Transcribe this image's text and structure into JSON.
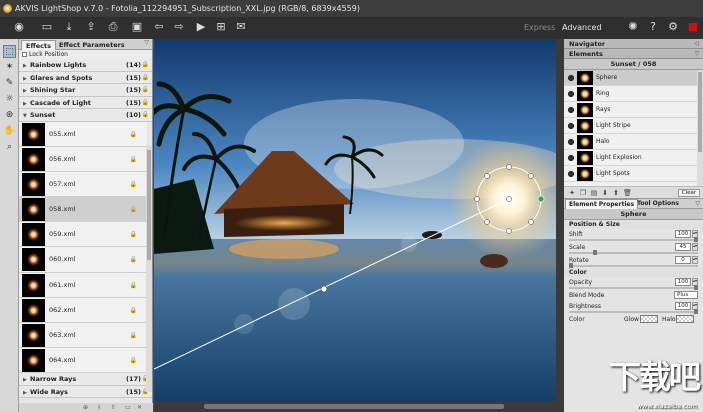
{
  "window": {
    "title": "AKVIS LightShop v.7.0 - Fotolia_112294951_Subscription_XXL.jpg (RGB/8, 6839x4559)"
  },
  "toolbar": {
    "icons": [
      "open-icon",
      "save-icon",
      "upload-icon",
      "print-icon",
      "fotolia-icon",
      "back-icon",
      "forward-icon",
      "run-icon",
      "share-icon",
      "settings-icon"
    ],
    "modes": {
      "express": "Express",
      "advanced": "Advanced"
    },
    "right_icons": [
      "lightbulb-icon",
      "help-icon",
      "gear-icon",
      "close-icon"
    ],
    "accent_color": "#cc1111"
  },
  "left_tools": [
    "select-tool",
    "magic-tool",
    "brush-tool",
    "light-tool",
    "stamp-tool",
    "hand-tool",
    "zoom-tool"
  ],
  "effects_panel": {
    "tabs": [
      "Effects",
      "Effect Parameters"
    ],
    "lock_position": "Lock Position",
    "categories_top": [
      {
        "name": "Rainbow Lights",
        "count": "(14)"
      },
      {
        "name": "Glares and Spots",
        "count": "(15)"
      },
      {
        "name": "Shining Star",
        "count": "(15)"
      },
      {
        "name": "Cascade of Light",
        "count": "(15)"
      },
      {
        "name": "Sunset",
        "count": "(10)"
      }
    ],
    "presets": [
      "055.xml",
      "056.xml",
      "057.xml",
      "058.xml",
      "059.xml",
      "060.xml",
      "061.xml",
      "062.xml",
      "063.xml",
      "064.xml"
    ],
    "selected_preset": "058.xml",
    "categories_bottom": [
      {
        "name": "Narrow Rays",
        "count": "(17)"
      },
      {
        "name": "Wide Rays",
        "count": "(15)"
      }
    ]
  },
  "navigator": {
    "title": "Navigator"
  },
  "elements": {
    "title": "Elements",
    "subtitle": "Sunset / 058",
    "items": [
      "Sphere",
      "Ring",
      "Rays",
      "Light Stripe",
      "Halo",
      "Light Explosion",
      "Light Spots"
    ],
    "selected": "Sphere",
    "clear_label": "Clear"
  },
  "properties": {
    "tabs": [
      "Element Properties",
      "Tool Options"
    ],
    "element_name": "Sphere",
    "position_size": "Position & Size",
    "shift": {
      "label": "Shift",
      "value": "100"
    },
    "scale": {
      "label": "Scale",
      "value": "45"
    },
    "rotate": {
      "label": "Rotate",
      "value": "0"
    },
    "color_section": "Color",
    "opacity": {
      "label": "Opacity",
      "value": "100"
    },
    "blend_mode": {
      "label": "Blend Mode",
      "value": "Plus"
    },
    "brightness": {
      "label": "Brightness",
      "value": "100"
    },
    "color_row": {
      "label": "Color",
      "glow": "Glow",
      "halo": "Halo"
    }
  },
  "watermark": {
    "brand": "下载吧",
    "url": "www.xiazaiba.com"
  }
}
